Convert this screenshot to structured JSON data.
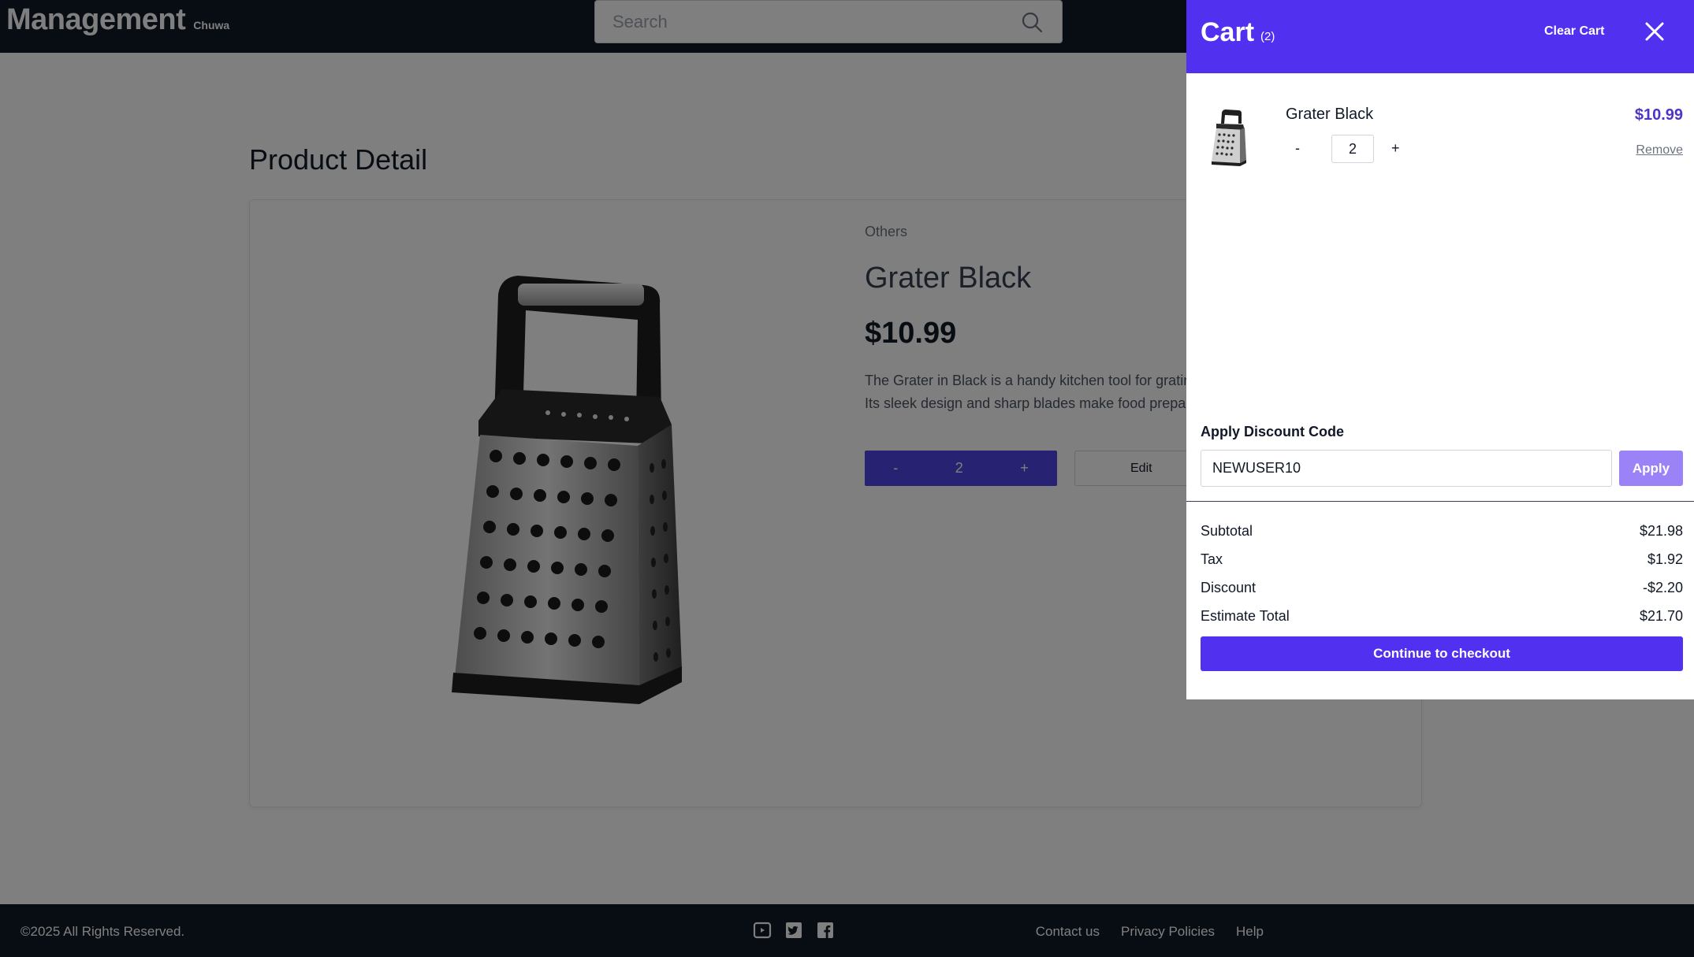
{
  "header": {
    "brand_title": "Management",
    "brand_sub": "Chuwa",
    "search_placeholder": "Search"
  },
  "main": {
    "page_title": "Product Detail",
    "product": {
      "category": "Others",
      "name": "Grater Black",
      "price": "$10.99",
      "description_line1": "The Grater in Black is a handy kitchen tool for gratin",
      "description_line2": "Its sleek design and sharp blades make food prepar",
      "qty_minus": "-",
      "qty_value": "2",
      "qty_plus": "+",
      "edit_label": "Edit"
    }
  },
  "cart": {
    "title": "Cart",
    "count": "(2)",
    "clear_label": "Clear Cart",
    "items": [
      {
        "name": "Grater Black",
        "price": "$10.99",
        "minus": "-",
        "qty": "2",
        "plus": "+",
        "remove_label": "Remove"
      }
    ],
    "discount": {
      "label": "Apply Discount Code",
      "value": "NEWUSER10",
      "apply_label": "Apply"
    },
    "summary": [
      {
        "label": "Subtotal",
        "value": "$21.98"
      },
      {
        "label": "Tax",
        "value": "$1.92"
      },
      {
        "label": "Discount",
        "value": "-$2.20"
      },
      {
        "label": "Estimate Total",
        "value": "$21.70"
      }
    ],
    "checkout_label": "Continue to checkout"
  },
  "footer": {
    "copyright": "©2025 All Rights Reserved.",
    "social_icons": [
      "youtube-icon",
      "twitter-icon",
      "facebook-icon"
    ],
    "links": [
      "Contact us",
      "Privacy Policies",
      "Help"
    ]
  },
  "colors": {
    "header_bg": "#111827",
    "accent": "#5130ef",
    "apply_disabled": "#9b83f7",
    "price_accent": "#4f33c6"
  }
}
